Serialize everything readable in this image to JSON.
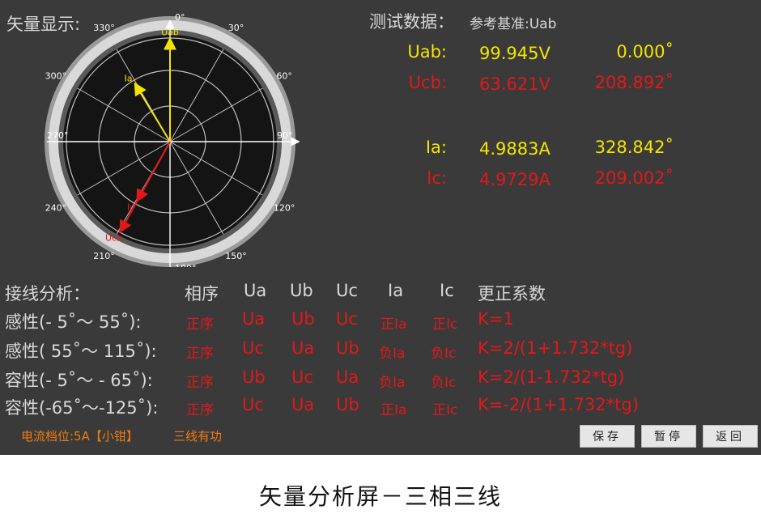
{
  "vector_panel": {
    "title": "矢量显示:",
    "angle_labels": [
      "0°",
      "30°",
      "60°",
      "90°",
      "120°",
      "150°",
      "180°",
      "210°",
      "240°",
      "270°",
      "300°",
      "330°"
    ],
    "vectors": [
      {
        "label": "Uab",
        "color": "#f5e400",
        "angle_deg": 0.0,
        "magnitude_ratio": 0.95
      },
      {
        "label": "Ucb",
        "color": "#e21818",
        "angle_deg": 208.892,
        "magnitude_ratio": 0.95
      },
      {
        "label": "Ia",
        "color": "#f5e400",
        "angle_deg": 328.842,
        "magnitude_ratio": 0.62
      },
      {
        "label": "Ic",
        "color": "#e21818",
        "angle_deg": 209.002,
        "magnitude_ratio": 0.62
      }
    ]
  },
  "measurement": {
    "title": "测试数据：",
    "reference": "参考基准:Uab",
    "rows": [
      {
        "label": "Uab:",
        "magnitude": "99.945V",
        "angle": "0.000˚",
        "color": "yellow"
      },
      {
        "label": "Ucb:",
        "magnitude": "63.621V",
        "angle": "208.892˚",
        "color": "red"
      },
      {
        "label": "Ia:",
        "magnitude": "4.9883A",
        "angle": "328.842˚",
        "color": "yellow"
      },
      {
        "label": "Ic:",
        "magnitude": "4.9729A",
        "angle": "209.002˚",
        "color": "red"
      }
    ]
  },
  "analysis": {
    "title": "接线分析：",
    "headers": [
      "相序",
      "Ua",
      "Ub",
      "Uc",
      "Ia",
      "Ic",
      "更正系数"
    ],
    "rows": [
      {
        "condition": "感性(- 5˚～  55˚):",
        "cells": [
          "正序",
          "Ua",
          "Ub",
          "Uc",
          "正Ia",
          "正Ic",
          "K=1"
        ]
      },
      {
        "condition": "感性( 55˚～ 115˚):",
        "cells": [
          "正序",
          "Uc",
          "Ua",
          "Ub",
          "负Ia",
          "负Ic",
          "K=2/(1+1.732*tg)"
        ]
      },
      {
        "condition": "容性(- 5˚～ - 65˚):",
        "cells": [
          "正序",
          "Ub",
          "Uc",
          "Ua",
          "负Ia",
          "负Ic",
          "K=2/(1-1.732*tg)"
        ]
      },
      {
        "condition": "容性(-65˚～-125˚):",
        "cells": [
          "正序",
          "Uc",
          "Ua",
          "Ub",
          "正Ia",
          "正Ic",
          "K=-2/(1+1.732*tg)"
        ]
      }
    ]
  },
  "status": {
    "current_range": "电流档位:5A【小钳】",
    "wiring_mode": "三线有功"
  },
  "buttons": {
    "save": "保存",
    "pause": "暂停",
    "back": "返回"
  },
  "caption": "矢量分析屏－三相三线"
}
